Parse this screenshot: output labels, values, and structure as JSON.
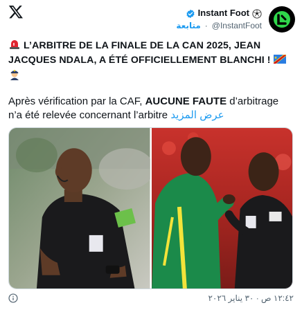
{
  "header": {
    "display_name": "Instant Foot",
    "handle": "@InstantFoot",
    "follow_label": "متابعة"
  },
  "tweet": {
    "headline": "L’ARBITRE DE LA FINALE DE LA CAN 2025, JEAN JACQUES NDALA, A ÉTÉ OFFICIELLEMENT BLANCHI !",
    "body_pre": "Après vérification par la CAF, ",
    "body_bold": "AUCUNE FAUTE",
    "body_post": " d’arbitrage n’a été relevée concernant l’arbitre ",
    "show_more": "عرض المزيد"
  },
  "footer": {
    "timestamp": "١٢:٤٢ ص · ٣٠ يناير ٢٠٢٦"
  },
  "colors": {
    "accent": "#1d9bf0",
    "verified": "#1d9bf0",
    "text": "#0f1419",
    "muted": "#536471"
  },
  "icons": [
    "x-logo-icon",
    "verified-badge-icon",
    "soccer-ball-icon",
    "siren-icon",
    "flag-drc-icon",
    "police-officer-icon",
    "info-icon"
  ]
}
